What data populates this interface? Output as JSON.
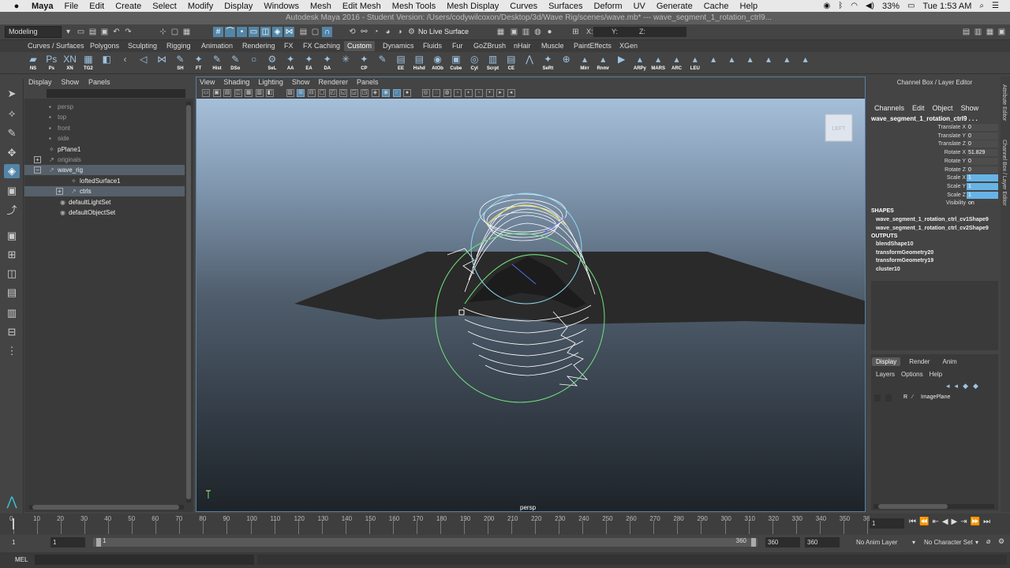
{
  "mac_menubar": {
    "app": "Maya",
    "items": [
      "File",
      "Edit",
      "Create",
      "Select",
      "Modify",
      "Display",
      "Windows",
      "Mesh",
      "Edit Mesh",
      "Mesh Tools",
      "Mesh Display",
      "Curves",
      "Surfaces",
      "Deform",
      "UV",
      "Generate",
      "Cache",
      "Help"
    ],
    "battery": "33%",
    "clock": "Tue 1:53 AM"
  },
  "window_title": "Autodesk Maya 2016 - Student Version: /Users/codywilcoxon/Desktop/3d/Wave Rig/scenes/wave.mb*   ---   wave_segment_1_rotation_ctrl9...",
  "status_line": {
    "mode": "Modeling",
    "live_surface": "No Live Surface",
    "x_label": "X:",
    "y_label": "Y:",
    "z_label": "Z:"
  },
  "shelf_tabs": [
    "Curves / Surfaces",
    "Polygons",
    "Sculpting",
    "Rigging",
    "Animation",
    "Rendering",
    "FX",
    "FX Caching",
    "Custom",
    "Dynamics",
    "Fluids",
    "Fur",
    "GoZBrush",
    "nHair",
    "Muscle",
    "PaintEffects",
    "XGen"
  ],
  "active_shelf": "Custom",
  "shelf_buttons": [
    {
      "label": "NS",
      "glyph": "▰"
    },
    {
      "label": "Ps",
      "glyph": "Ps"
    },
    {
      "label": "XN",
      "glyph": "XN"
    },
    {
      "label": "TG2",
      "glyph": "▦"
    },
    {
      "label": "",
      "glyph": "◧"
    },
    {
      "label": "",
      "glyph": "‹"
    },
    {
      "label": "",
      "glyph": "◁"
    },
    {
      "label": "",
      "glyph": "⋈"
    },
    {
      "label": "SH",
      "glyph": "✎"
    },
    {
      "label": "FT",
      "glyph": "✦"
    },
    {
      "label": "Hist",
      "glyph": "✎"
    },
    {
      "label": "DSo",
      "glyph": "✎"
    },
    {
      "label": "",
      "glyph": "○"
    },
    {
      "label": "SeL",
      "glyph": "⚙"
    },
    {
      "label": "AA",
      "glyph": "✦"
    },
    {
      "label": "EA",
      "glyph": "✦"
    },
    {
      "label": "DA",
      "glyph": "✦"
    },
    {
      "label": "",
      "glyph": "✳"
    },
    {
      "label": "CP",
      "glyph": "✦"
    },
    {
      "label": "",
      "glyph": "✎"
    },
    {
      "label": "EE",
      "glyph": "▤"
    },
    {
      "label": "Hshd",
      "glyph": "▤"
    },
    {
      "label": "AtOb",
      "glyph": "◉"
    },
    {
      "label": "Cube",
      "glyph": "▣"
    },
    {
      "label": "Cyl",
      "glyph": "◎"
    },
    {
      "label": "Scrpt",
      "glyph": "▥"
    },
    {
      "label": "CE",
      "glyph": "▤"
    },
    {
      "label": "",
      "glyph": "⋀"
    },
    {
      "label": "SeRt",
      "glyph": "✦"
    },
    {
      "label": "",
      "glyph": "⊕"
    },
    {
      "label": "Mirr",
      "glyph": "▴"
    },
    {
      "label": "Rnmr",
      "glyph": "▴"
    },
    {
      "label": "",
      "glyph": "▶"
    },
    {
      "label": "ARPy",
      "glyph": "▴"
    },
    {
      "label": "MARS",
      "glyph": "▴"
    },
    {
      "label": "ARC",
      "glyph": "▴"
    },
    {
      "label": "LEU",
      "glyph": "▴"
    },
    {
      "label": "",
      "glyph": "▴"
    },
    {
      "label": "",
      "glyph": "▴"
    },
    {
      "label": "",
      "glyph": "▴"
    },
    {
      "label": "",
      "glyph": "▴"
    },
    {
      "label": "",
      "glyph": "▴"
    },
    {
      "label": "",
      "glyph": "▴"
    }
  ],
  "outliner": {
    "menu": [
      "Display",
      "Show",
      "Panels"
    ],
    "rows": [
      {
        "label": "persp",
        "dim": true,
        "indent": 2,
        "icon": "▪"
      },
      {
        "label": "top",
        "dim": true,
        "indent": 2,
        "icon": "▪"
      },
      {
        "label": "front",
        "dim": true,
        "indent": 2,
        "icon": "▪"
      },
      {
        "label": "side",
        "dim": true,
        "indent": 2,
        "icon": "▪"
      },
      {
        "label": "pPlane1",
        "dim": false,
        "indent": 2,
        "icon": "✧"
      },
      {
        "label": "originals",
        "dim": true,
        "indent": 2,
        "icon": "↗",
        "expander": "+"
      },
      {
        "label": "wave_rig",
        "dim": false,
        "indent": 2,
        "icon": "↗",
        "expander": "−",
        "selected": true
      },
      {
        "label": "loftedSurface1",
        "dim": false,
        "indent": 4,
        "icon": "✧"
      },
      {
        "label": "ctrls",
        "dim": false,
        "indent": 4,
        "icon": "↗",
        "expander": "+",
        "selected": true
      },
      {
        "label": "defaultLightSet",
        "dim": false,
        "indent": 3,
        "icon": "◉"
      },
      {
        "label": "defaultObjectSet",
        "dim": false,
        "indent": 3,
        "icon": "◉"
      }
    ]
  },
  "viewport": {
    "menu": [
      "View",
      "Shading",
      "Lighting",
      "Show",
      "Renderer",
      "Panels"
    ],
    "camera": "persp",
    "viewcube": "LEFT"
  },
  "channel_box": {
    "title": "Channel Box / Layer Editor",
    "tabs": [
      "Channels",
      "Edit",
      "Object",
      "Show"
    ],
    "object": "wave_segment_1_rotation_ctrl9 . . .",
    "attributes": [
      {
        "name": "Translate X",
        "value": "0",
        "state": "locked"
      },
      {
        "name": "Translate Y",
        "value": "0",
        "state": "locked"
      },
      {
        "name": "Translate Z",
        "value": "0",
        "state": "locked"
      },
      {
        "name": "Rotate X",
        "value": "51.829",
        "state": "normal"
      },
      {
        "name": "Rotate Y",
        "value": "0",
        "state": "locked"
      },
      {
        "name": "Rotate Z",
        "value": "0",
        "state": "locked"
      },
      {
        "name": "Scale X",
        "value": "1",
        "state": "keyed"
      },
      {
        "name": "Scale Y",
        "value": "1",
        "state": "keyed"
      },
      {
        "name": "Scale Z",
        "value": "1",
        "state": "keyed"
      },
      {
        "name": "Visibility",
        "value": "on",
        "state": "plain"
      }
    ],
    "shapes_header": "SHAPES",
    "shapes": [
      "wave_segment_1_rotation_ctrl_cv1Shape9",
      "wave_segment_1_rotation_ctrl_cv2Shape9"
    ],
    "outputs_header": "OUTPUTS",
    "outputs": [
      "blendShape10",
      "transformGeometry20",
      "transformGeometry19",
      "cluster10"
    ]
  },
  "layer_editor": {
    "tabs": [
      "Display",
      "Render",
      "Anim"
    ],
    "active_tab": "Display",
    "menu": [
      "Layers",
      "Options",
      "Help"
    ],
    "layer_flag": "R",
    "layer_name": "ImagePlane"
  },
  "side_tabs": [
    "Attribute Editor",
    "Channel Box / Layer Editor"
  ],
  "time_slider": {
    "ticks": [
      "0",
      "10",
      "20",
      "30",
      "40",
      "50",
      "60",
      "70",
      "80",
      "90",
      "100",
      "110",
      "120",
      "130",
      "140",
      "150",
      "160",
      "170",
      "180",
      "190",
      "200",
      "210",
      "220",
      "230",
      "240",
      "250",
      "260",
      "270",
      "280",
      "290",
      "300",
      "310",
      "320",
      "330",
      "340",
      "350",
      "36"
    ],
    "current_frame": "1"
  },
  "range_slider": {
    "start": "1",
    "anim_start": "1",
    "range_start_label": "1",
    "range_end_label": "360",
    "anim_end": "360",
    "end": "360",
    "anim_layer": "No Anim Layer",
    "character_set": "No Character Set"
  },
  "command_line": {
    "language": "MEL"
  }
}
